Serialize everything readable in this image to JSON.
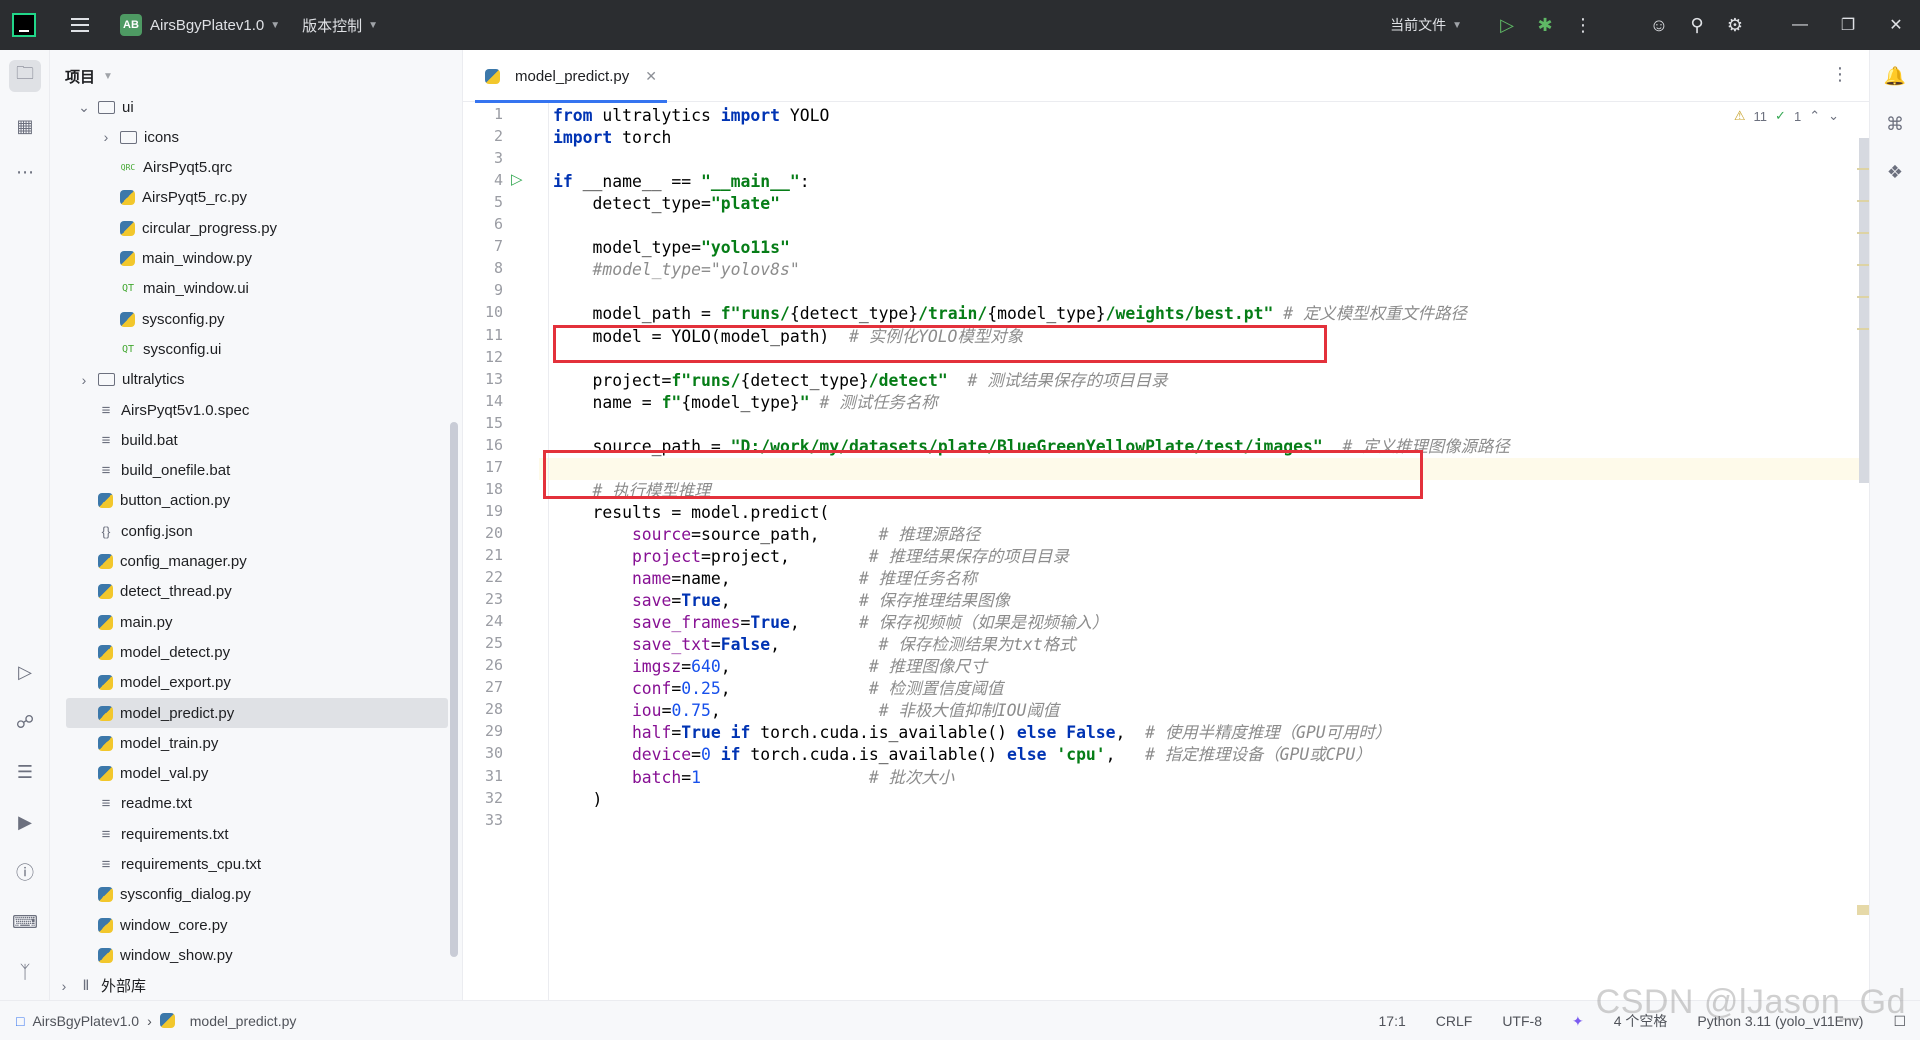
{
  "titlebar": {
    "project_badge": "AB",
    "project_name": "AirsBgyPlatev1.0",
    "vcs_label": "版本控制",
    "run_config": "当前文件"
  },
  "project_panel": {
    "title": "项目",
    "tree": [
      {
        "label": "ui",
        "type": "folder",
        "depth": 1,
        "expanded": true
      },
      {
        "label": "icons",
        "type": "folder",
        "depth": 2,
        "expanded": false
      },
      {
        "label": "AirsPyqt5.qrc",
        "type": "qrc",
        "depth": 2
      },
      {
        "label": "AirsPyqt5_rc.py",
        "type": "py",
        "depth": 2
      },
      {
        "label": "circular_progress.py",
        "type": "py",
        "depth": 2
      },
      {
        "label": "main_window.py",
        "type": "py",
        "depth": 2
      },
      {
        "label": "main_window.ui",
        "type": "qt",
        "depth": 2
      },
      {
        "label": "sysconfig.py",
        "type": "py",
        "depth": 2
      },
      {
        "label": "sysconfig.ui",
        "type": "qt",
        "depth": 2
      },
      {
        "label": "ultralytics",
        "type": "folder",
        "depth": 1,
        "expanded": false
      },
      {
        "label": "AirsPyqt5v1.0.spec",
        "type": "txt",
        "depth": 1
      },
      {
        "label": "build.bat",
        "type": "txt",
        "depth": 1
      },
      {
        "label": "build_onefile.bat",
        "type": "txt",
        "depth": 1
      },
      {
        "label": "button_action.py",
        "type": "py",
        "depth": 1
      },
      {
        "label": "config.json",
        "type": "json",
        "depth": 1
      },
      {
        "label": "config_manager.py",
        "type": "py",
        "depth": 1
      },
      {
        "label": "detect_thread.py",
        "type": "py",
        "depth": 1
      },
      {
        "label": "main.py",
        "type": "py",
        "depth": 1
      },
      {
        "label": "model_detect.py",
        "type": "py",
        "depth": 1
      },
      {
        "label": "model_export.py",
        "type": "py",
        "depth": 1
      },
      {
        "label": "model_predict.py",
        "type": "py",
        "depth": 1,
        "selected": true
      },
      {
        "label": "model_train.py",
        "type": "py",
        "depth": 1
      },
      {
        "label": "model_val.py",
        "type": "py",
        "depth": 1
      },
      {
        "label": "readme.txt",
        "type": "txt",
        "depth": 1
      },
      {
        "label": "requirements.txt",
        "type": "txt",
        "depth": 1
      },
      {
        "label": "requirements_cpu.txt",
        "type": "txt",
        "depth": 1
      },
      {
        "label": "sysconfig_dialog.py",
        "type": "py",
        "depth": 1
      },
      {
        "label": "window_core.py",
        "type": "py",
        "depth": 1
      },
      {
        "label": "window_show.py",
        "type": "py",
        "depth": 1
      },
      {
        "label": "外部库",
        "type": "lib",
        "depth": 0,
        "expanded": false
      }
    ]
  },
  "editor": {
    "tab_label": "model_predict.py",
    "warnings": "11",
    "ok_count": "1",
    "line_numbers": [
      "1",
      "2",
      "3",
      "4",
      "5",
      "6",
      "7",
      "8",
      "9",
      "10",
      "11",
      "12",
      "13",
      "14",
      "15",
      "16",
      "17",
      "18",
      "19",
      "20",
      "21",
      "22",
      "23",
      "24",
      "25",
      "26",
      "27",
      "28",
      "29",
      "30",
      "31",
      "32",
      "33"
    ],
    "code_lines": [
      [
        [
          "k",
          "from"
        ],
        [
          "i",
          " ultralytics "
        ],
        [
          "k",
          "import"
        ],
        [
          "i",
          " YOLO"
        ]
      ],
      [
        [
          "k",
          "import"
        ],
        [
          "i",
          " torch"
        ]
      ],
      [],
      [
        [
          "k",
          "if"
        ],
        [
          "i",
          " __name__ == "
        ],
        [
          "s",
          "\"__main__\""
        ],
        [
          "i",
          ":"
        ]
      ],
      [
        [
          "i",
          "    detect_type="
        ],
        [
          "s",
          "\"plate\""
        ]
      ],
      [],
      [
        [
          "i",
          "    model_type="
        ],
        [
          "s",
          "\"yolo11s\""
        ]
      ],
      [
        [
          "c",
          "    #model_type=\"yolov8s\""
        ]
      ],
      [],
      [
        [
          "i",
          "    model_path = "
        ],
        [
          "s",
          "f\"runs/"
        ],
        [
          "i",
          "{detect_type}"
        ],
        [
          "s",
          "/train/"
        ],
        [
          "i",
          "{model_type}"
        ],
        [
          "s",
          "/weights/best.pt\""
        ],
        [
          "c",
          " # 定义模型权重文件路径"
        ]
      ],
      [
        [
          "i",
          "    model = YOLO(model_path)  "
        ],
        [
          "c",
          "# 实例化YOLO模型对象"
        ]
      ],
      [],
      [
        [
          "i",
          "    project="
        ],
        [
          "s",
          "f\"runs/"
        ],
        [
          "i",
          "{detect_type}"
        ],
        [
          "s",
          "/detect\""
        ],
        [
          "c",
          "  # 测试结果保存的项目目录"
        ]
      ],
      [
        [
          "i",
          "    name = "
        ],
        [
          "s",
          "f\""
        ],
        [
          "i",
          "{model_type}"
        ],
        [
          "s",
          "\""
        ],
        [
          "c",
          " # 测试任务名称"
        ]
      ],
      [],
      [
        [
          "i",
          "    source_path = "
        ],
        [
          "s",
          "\"D:/work/my/datasets/plate/BlueGreenYellowPlate/test/images\""
        ],
        [
          "c",
          "  # 定义推理图像源路径"
        ]
      ],
      [],
      [
        [
          "c",
          "    # 执行模型推理"
        ]
      ],
      [
        [
          "i",
          "    results = model.predict("
        ]
      ],
      [
        [
          "p",
          "        source"
        ],
        [
          "i",
          "=source_path,      "
        ],
        [
          "c",
          "# 推理源路径"
        ]
      ],
      [
        [
          "p",
          "        project"
        ],
        [
          "i",
          "=project,        "
        ],
        [
          "c",
          "# 推理结果保存的项目目录"
        ]
      ],
      [
        [
          "p",
          "        name"
        ],
        [
          "i",
          "=name,             "
        ],
        [
          "c",
          "# 推理任务名称"
        ]
      ],
      [
        [
          "p",
          "        save"
        ],
        [
          "i",
          "="
        ],
        [
          "k",
          "True"
        ],
        [
          "i",
          ",             "
        ],
        [
          "c",
          "# 保存推理结果图像"
        ]
      ],
      [
        [
          "p",
          "        save_frames"
        ],
        [
          "i",
          "="
        ],
        [
          "k",
          "True"
        ],
        [
          "i",
          ",      "
        ],
        [
          "c",
          "# 保存视频帧（如果是视频输入）"
        ]
      ],
      [
        [
          "p",
          "        save_txt"
        ],
        [
          "i",
          "="
        ],
        [
          "k",
          "False"
        ],
        [
          "i",
          ",          "
        ],
        [
          "c",
          "# 保存检测结果为txt格式"
        ]
      ],
      [
        [
          "p",
          "        imgsz"
        ],
        [
          "i",
          "="
        ],
        [
          "num",
          "640"
        ],
        [
          "i",
          ",              "
        ],
        [
          "c",
          "# 推理图像尺寸"
        ]
      ],
      [
        [
          "p",
          "        conf"
        ],
        [
          "i",
          "="
        ],
        [
          "num",
          "0.25"
        ],
        [
          "i",
          ",              "
        ],
        [
          "c",
          "# 检测置信度阈值"
        ]
      ],
      [
        [
          "p",
          "        iou"
        ],
        [
          "i",
          "="
        ],
        [
          "num",
          "0.75"
        ],
        [
          "i",
          ",                "
        ],
        [
          "c",
          "# 非极大值抑制IOU阈值"
        ]
      ],
      [
        [
          "p",
          "        half"
        ],
        [
          "i",
          "="
        ],
        [
          "k",
          "True"
        ],
        [
          "i",
          " "
        ],
        [
          "k",
          "if"
        ],
        [
          "i",
          " torch.cuda.is_available() "
        ],
        [
          "k",
          "else"
        ],
        [
          "i",
          " "
        ],
        [
          "k",
          "False"
        ],
        [
          "i",
          ",  "
        ],
        [
          "c",
          "# 使用半精度推理（GPU可用时）"
        ]
      ],
      [
        [
          "p",
          "        device"
        ],
        [
          "i",
          "="
        ],
        [
          "num",
          "0"
        ],
        [
          "i",
          " "
        ],
        [
          "k",
          "if"
        ],
        [
          "i",
          " torch.cuda.is_available() "
        ],
        [
          "k",
          "else"
        ],
        [
          "i",
          " "
        ],
        [
          "s",
          "'cpu'"
        ],
        [
          "i",
          ",   "
        ],
        [
          "c",
          "# 指定推理设备（GPU或CPU）"
        ]
      ],
      [
        [
          "p",
          "        batch"
        ],
        [
          "i",
          "="
        ],
        [
          "num",
          "1"
        ],
        [
          "i",
          "                 "
        ],
        [
          "c",
          "# 批次大小"
        ]
      ],
      [
        [
          "i",
          "    )"
        ]
      ],
      []
    ]
  },
  "statusbar": {
    "crumb_project": "AirsBgyPlatev1.0",
    "crumb_file": "model_predict.py",
    "position": "17:1",
    "line_sep": "CRLF",
    "encoding": "UTF-8",
    "indent": "4 个空格",
    "interpreter": "Python 3.11 (yolo_v11Env)",
    "watermark": "CSDN @lJason_Gd"
  },
  "colors": {
    "accent": "#3574f0",
    "highlight_box": "#e3313b",
    "keyword": "#0033b3",
    "string": "#067d17",
    "comment": "#8c8c8c"
  }
}
